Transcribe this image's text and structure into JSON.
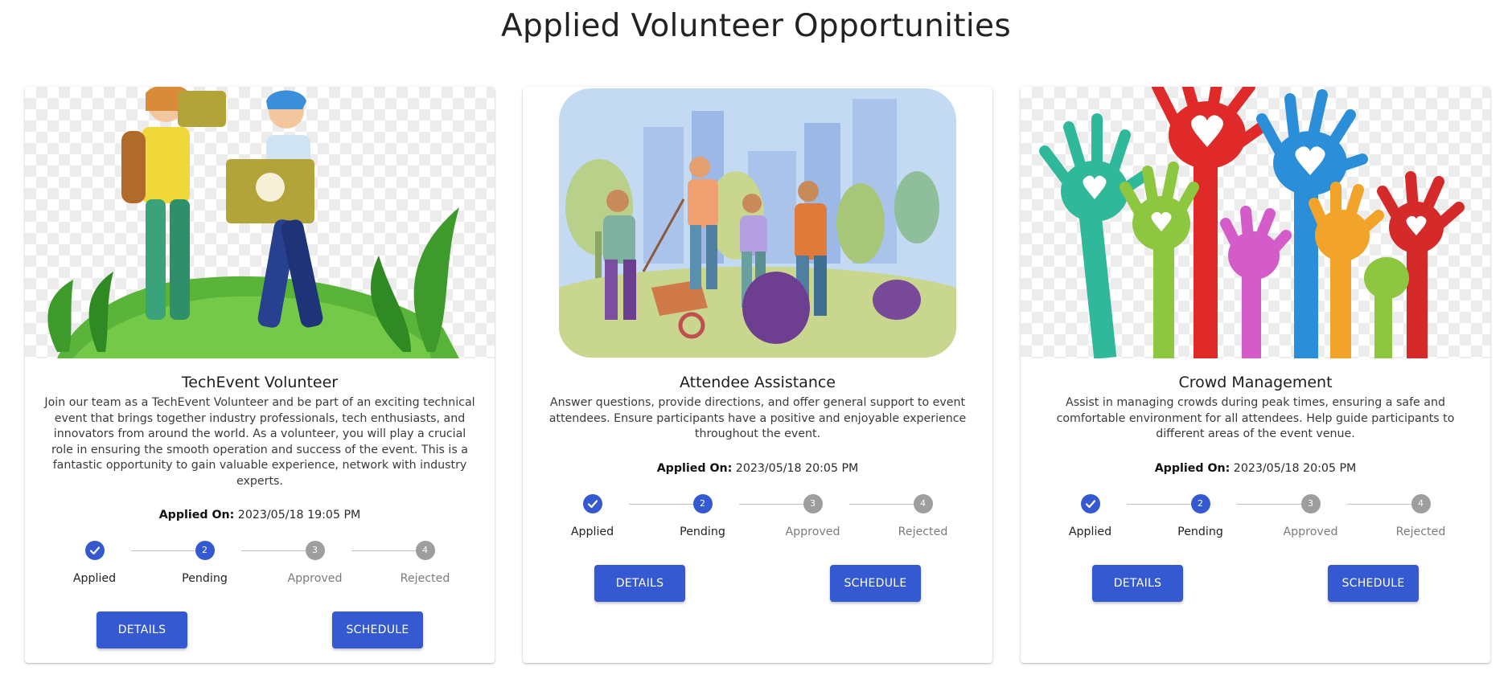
{
  "page": {
    "title": "Applied Volunteer Opportunities"
  },
  "step_labels": [
    "Applied",
    "Pending",
    "Approved",
    "Rejected"
  ],
  "step_numbers": [
    "1",
    "2",
    "3",
    "4"
  ],
  "applied_on_label": "Applied On:",
  "colors": {
    "primary": "#3559d0",
    "inactive_step": "#9e9e9e"
  },
  "cards": [
    {
      "title": "TechEvent Volunteer",
      "description": "Join our team as a TechEvent Volunteer and be part of an exciting technical event that brings together industry professionals, tech enthusiasts, and innovators from around the world. As a volunteer, you will play a crucial role in ensuring the smooth operation and success of the event. This is a fantastic opportunity to gain valuable experience, network with industry experts.",
      "applied_on": "2023/05/18 19:05 PM",
      "current_step": 2,
      "details_label": "DETAILS",
      "schedule_label": "SCHEDULE",
      "image_icon": "volunteers-carrying-boxes-illustration"
    },
    {
      "title": "Attendee Assistance",
      "description": "Answer questions, provide directions, and offer general support to event attendees. Ensure participants have a positive and enjoyable experience throughout the event.",
      "applied_on": "2023/05/18 20:05 PM",
      "current_step": 2,
      "details_label": "DETAILS",
      "schedule_label": "SCHEDULE",
      "image_icon": "park-cleanup-volunteers-illustration"
    },
    {
      "title": "Crowd Management",
      "description": "Assist in managing crowds during peak times, ensuring a safe and comfortable environment for all attendees. Help guide participants to different areas of the event venue.",
      "applied_on": "2023/05/18 20:05 PM",
      "current_step": 2,
      "details_label": "DETAILS",
      "schedule_label": "SCHEDULE",
      "image_icon": "raised-hands-with-hearts-illustration"
    }
  ]
}
